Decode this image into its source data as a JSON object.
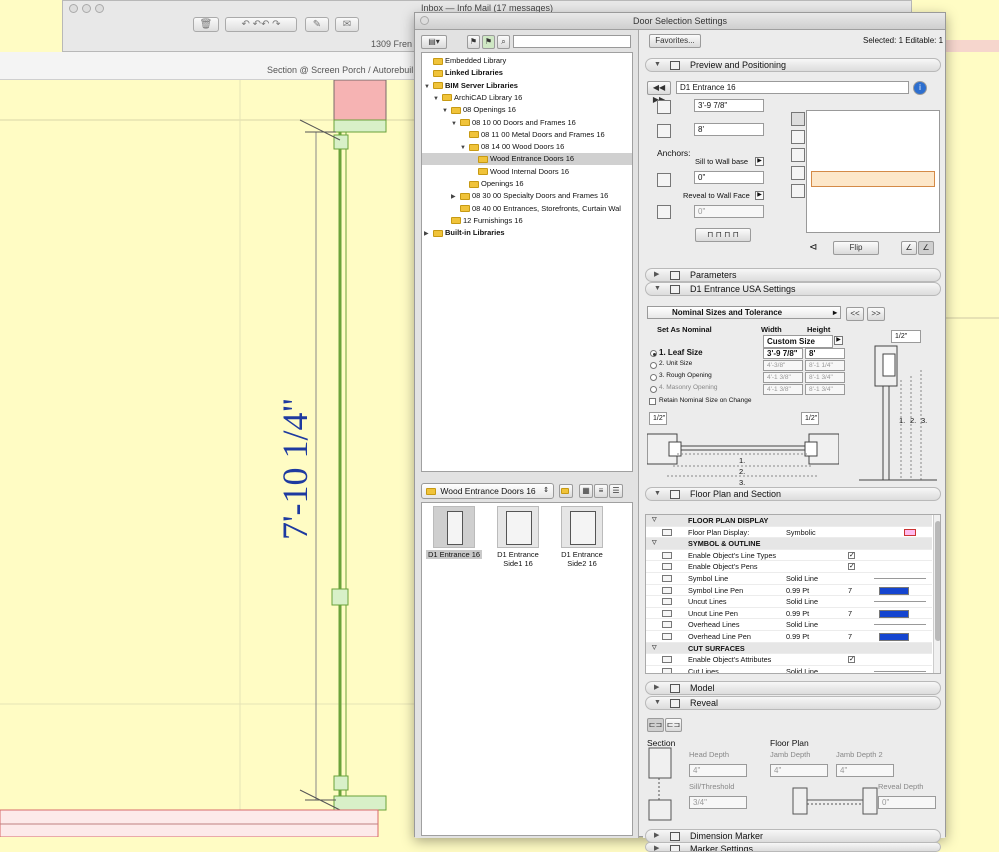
{
  "mail_window": {
    "title": "Inbox — Info Mail (17 messages)",
    "address_fragment": "1309 Fren"
  },
  "cad_view": {
    "section_title": "Section @ Screen Porch / Autorebuil",
    "dimension_text": "7'-10 1/4\""
  },
  "dialog": {
    "title": "Door Selection Settings",
    "favorites_label": "Favorites...",
    "selected_info": "Selected: 1 Editable: 1"
  },
  "library_tree": [
    {
      "label": "Embedded Library",
      "indent": 0,
      "bold": false,
      "selected": false,
      "arrow": ""
    },
    {
      "label": "Linked Libraries",
      "indent": 0,
      "bold": true,
      "selected": false,
      "arrow": ""
    },
    {
      "label": "BIM Server Libraries",
      "indent": 0,
      "bold": true,
      "selected": false,
      "arrow": "▼"
    },
    {
      "label": "ArchiCAD Library 16",
      "indent": 1,
      "bold": false,
      "selected": false,
      "arrow": "▼"
    },
    {
      "label": "08 Openings 16",
      "indent": 2,
      "bold": false,
      "selected": false,
      "arrow": "▼"
    },
    {
      "label": "08 10 00 Doors and Frames 16",
      "indent": 3,
      "bold": false,
      "selected": false,
      "arrow": "▼"
    },
    {
      "label": "08 11 00 Metal Doors and Frames 16",
      "indent": 4,
      "bold": false,
      "selected": false,
      "arrow": ""
    },
    {
      "label": "08 14 00 Wood Doors 16",
      "indent": 4,
      "bold": false,
      "selected": false,
      "arrow": "▼"
    },
    {
      "label": "Wood Entrance Doors 16",
      "indent": 5,
      "bold": false,
      "selected": true,
      "arrow": ""
    },
    {
      "label": "Wood Internal Doors 16",
      "indent": 5,
      "bold": false,
      "selected": false,
      "arrow": ""
    },
    {
      "label": "Openings 16",
      "indent": 4,
      "bold": false,
      "selected": false,
      "arrow": ""
    },
    {
      "label": "08 30 00 Specialty Doors and Frames 16",
      "indent": 3,
      "bold": false,
      "selected": false,
      "arrow": "▶"
    },
    {
      "label": "08 40 00 Entrances, Storefronts, Curtain Wal",
      "indent": 3,
      "bold": false,
      "selected": false,
      "arrow": ""
    },
    {
      "label": "12 Furnishings 16",
      "indent": 2,
      "bold": false,
      "selected": false,
      "arrow": ""
    },
    {
      "label": "Built-in Libraries",
      "indent": 0,
      "bold": true,
      "selected": false,
      "arrow": "▶"
    }
  ],
  "folder_select": "Wood Entrance Doors 16",
  "thumbnails": [
    {
      "label": "D1 Entrance 16",
      "selected": true,
      "side": false
    },
    {
      "label": "D1 Entrance\nSide1 16",
      "selected": false,
      "side": true
    },
    {
      "label": "D1 Entrance\nSide2 16",
      "selected": false,
      "side": true
    }
  ],
  "preview_panel": {
    "header": "Preview and Positioning",
    "object_name": "D1 Entrance 16",
    "width": "3'-9 7/8\"",
    "height": "8'",
    "anchors_label": "Anchors:",
    "sill_label": "Sill to Wall base",
    "sill_value": "0\"",
    "reveal_label": "Reveal to Wall Face",
    "reveal_value": "0\"",
    "flip_label": "Flip"
  },
  "parameters_header": "Parameters",
  "usa_settings": {
    "header": "D1 Entrance USA Settings",
    "page_select": "Nominal Sizes and Tolerance",
    "prev_label": "<<",
    "next_label": ">>",
    "set_as_nominal": "Set As Nominal",
    "width_col": "Width",
    "height_col": "Height",
    "custom_size": "Custom Size",
    "options": [
      {
        "label": "1. Leaf Size",
        "selected": true,
        "width": "3'-9 7/8\"",
        "height": "8'",
        "disabled": false
      },
      {
        "label": "2. Unit Size",
        "selected": false,
        "width": "4'-3/8\"",
        "height": "8'-1 1/4\"",
        "disabled": false
      },
      {
        "label": "3. Rough Opening",
        "selected": false,
        "width": "4'-1 3/8\"",
        "height": "8'-1 3/4\"",
        "disabled": false
      },
      {
        "label": "4. Masonry Opening",
        "selected": false,
        "width": "4'-1 3/8\"",
        "height": "8'-1 3/4\"",
        "disabled": true
      }
    ],
    "retain_label": "Retain Nominal Size on Change",
    "tol_left": "1/2\"",
    "tol_right": "1/2\"",
    "tol_top": "1/2\"",
    "plan_marks": [
      "1.",
      "2.",
      "3."
    ],
    "section_marks": [
      "1.",
      "2.",
      "3."
    ]
  },
  "floor_plan_section": {
    "header": "Floor Plan and Section",
    "rows": [
      {
        "type": "hdr",
        "label": "FLOOR PLAN DISPLAY"
      },
      {
        "type": "row",
        "label": "Floor Plan Display:",
        "value": "Symbolic",
        "extra": "",
        "widget": "none"
      },
      {
        "type": "hdr",
        "label": "SYMBOL & OUTLINE"
      },
      {
        "type": "row",
        "label": "Enable Object's Line Types",
        "value": "",
        "extra": "",
        "widget": "check"
      },
      {
        "type": "row",
        "label": "Enable Object's Pens",
        "value": "",
        "extra": "",
        "widget": "check"
      },
      {
        "type": "row",
        "label": "Symbol Line",
        "value": "Solid Line",
        "extra": "",
        "widget": "line"
      },
      {
        "type": "row",
        "label": "Symbol Line Pen",
        "value": "0.99 Pt",
        "extra": "7",
        "widget": "pen"
      },
      {
        "type": "row",
        "label": "Uncut Lines",
        "value": "Solid Line",
        "extra": "",
        "widget": "line"
      },
      {
        "type": "row",
        "label": "Uncut Line Pen",
        "value": "0.99 Pt",
        "extra": "7",
        "widget": "pen"
      },
      {
        "type": "row",
        "label": "Overhead Lines",
        "value": "Solid Line",
        "extra": "",
        "widget": "line"
      },
      {
        "type": "row",
        "label": "Overhead Line Pen",
        "value": "0.99 Pt",
        "extra": "7",
        "widget": "pen"
      },
      {
        "type": "hdr",
        "label": "CUT SURFACES"
      },
      {
        "type": "row",
        "label": "Enable Object's Attributes",
        "value": "",
        "extra": "",
        "widget": "check"
      },
      {
        "type": "row",
        "label": "Cut Lines",
        "value": "Solid Line",
        "extra": "",
        "widget": "line"
      }
    ]
  },
  "model_header": "Model",
  "reveal": {
    "header": "Reveal",
    "section_label": "Section",
    "floor_plan_label": "Floor Plan",
    "head_depth_label": "Head Depth",
    "head_depth_value": "4\"",
    "jamb_depth_label": "Jamb Depth",
    "jamb_depth_value": "4\"",
    "jamb_depth2_label": "Jamb Depth 2",
    "jamb_depth2_value": "4\"",
    "sill_label": "Sill/Threshold",
    "sill_value": "3/4\"",
    "reveal_depth_label": "Reveal Depth",
    "reveal_depth_value": "0\""
  },
  "dimension_marker_header": "Dimension Marker",
  "marker_settings_header": "Marker Settings"
}
